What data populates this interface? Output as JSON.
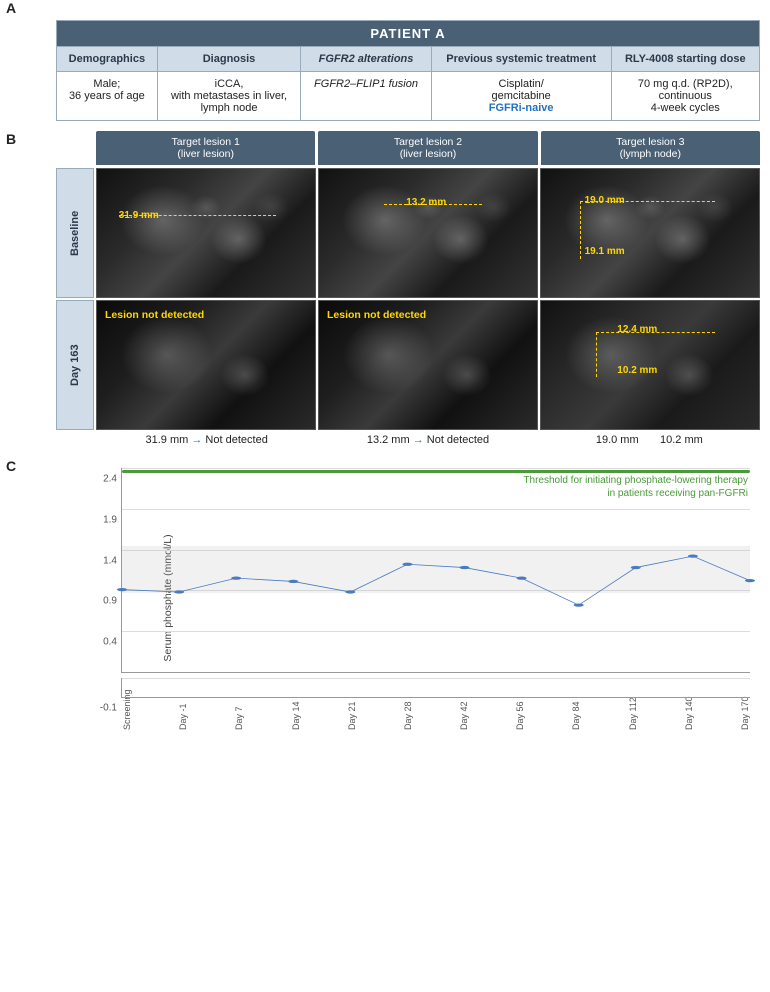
{
  "title": "PATIENT A",
  "sectionA": {
    "label": "A",
    "headers": [
      "Demographics",
      "Diagnosis",
      "FGFR2 alterations",
      "Previous systemic treatment",
      "RLY-4008 starting dose"
    ],
    "data": {
      "demographics": "Male;\n36 years of age",
      "diagnosis": "iCCA,\nwith metastases in liver,\nlymph node",
      "fgfr2": "FGFR2–FLIP1 fusion",
      "previous_treatment_1": "Cisplatin/\ngemcitabine",
      "previous_treatment_2": "FGFRi-naive",
      "rly": "70 mg q.d. (RP2D),\ncontinuous\n4-week cycles"
    }
  },
  "sectionB": {
    "label": "B",
    "lesions": [
      {
        "title": "Target lesion 1",
        "subtitle": "(liver lesion)"
      },
      {
        "title": "Target lesion 2",
        "subtitle": "(liver lesion)"
      },
      {
        "title": "Target lesion 3",
        "subtitle": "(lymph node)"
      }
    ],
    "rows": [
      "Baseline",
      "Day 163"
    ],
    "baseline_measurements": [
      {
        "value": "31.9 mm",
        "x": "28%",
        "y": "35%"
      },
      {
        "value": "13.2 mm",
        "x": "38%",
        "y": "28%"
      },
      {
        "values": [
          "19.0 mm",
          "19.1 mm"
        ]
      }
    ],
    "day163_measurements": [
      {
        "label": "Lesion not detected"
      },
      {
        "label": "Lesion not detected"
      },
      {
        "values": [
          "12.4 mm",
          "10.2 mm"
        ]
      }
    ],
    "summary": [
      "31.9 mm → Not detected",
      "13.2 mm → Not detected",
      "19.0 mm      10.2 mm"
    ]
  },
  "sectionC": {
    "label": "C",
    "yAxis": {
      "label": "Serum phosphate (mmol/L)",
      "ticks": [
        "-0.1",
        "0.4",
        "0.9",
        "1.4",
        "1.9",
        "2.4"
      ]
    },
    "threshold": {
      "value": 2.4,
      "label": "Threshold for initiating phosphate-lowering therapy\nin patients receiving pan-FGFRi",
      "color": "#4a9a3a"
    },
    "normalRange": {
      "min": 0.87,
      "max": 1.45
    },
    "xLabels": [
      "Screening",
      "Day -1",
      "Day 7",
      "Day 14",
      "Day 21",
      "Day 28",
      "Day 42",
      "Day 56",
      "Day 84",
      "Day 112",
      "Day 140",
      "Day 170"
    ],
    "dataPoints": [
      {
        "x": "Screening",
        "y": 0.91
      },
      {
        "x": "Day -1",
        "y": 0.88
      },
      {
        "x": "Day 7",
        "y": 1.05
      },
      {
        "x": "Day 14",
        "y": 1.01
      },
      {
        "x": "Day 21",
        "y": 0.88
      },
      {
        "x": "Day 28",
        "y": 1.22
      },
      {
        "x": "Day 42",
        "y": 1.18
      },
      {
        "x": "Day 56",
        "y": 1.05
      },
      {
        "x": "Day 84",
        "y": 0.72
      },
      {
        "x": "Day 112",
        "y": 1.18
      },
      {
        "x": "Day 140",
        "y": 1.32
      },
      {
        "x": "Day 170",
        "y": 1.02
      }
    ]
  }
}
